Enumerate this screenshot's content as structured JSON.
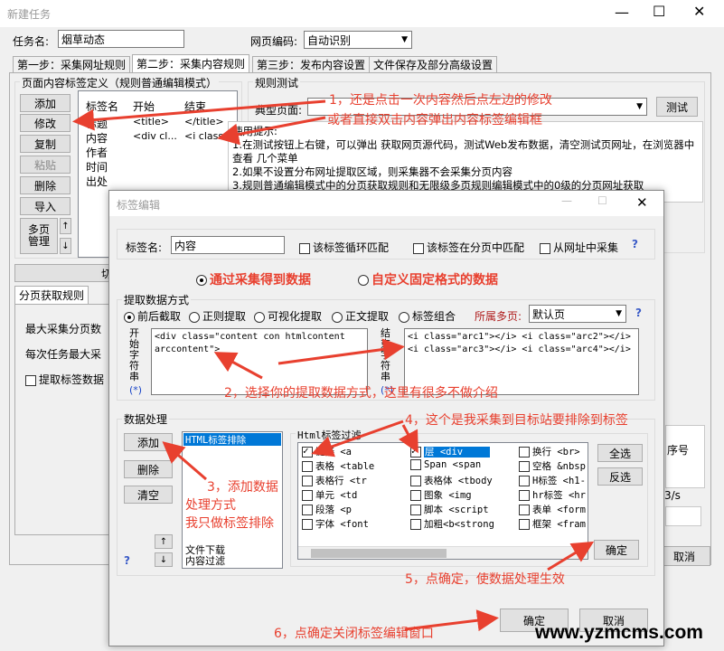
{
  "main_window": {
    "title": "新建任务",
    "task_name_label": "任务名:",
    "task_name_value": "烟草动态",
    "encoding_label": "网页编码:",
    "encoding_value": "自动识别",
    "tabs": [
      "第一步：采集网址规则",
      "第二步：采集内容规则",
      "第三步：发布内容设置",
      "文件保存及部分高级设置"
    ],
    "left_panel_title": "页面内容标签定义（规则普通编辑模式）",
    "buttons": [
      "添加",
      "修改",
      "复制",
      "粘贴",
      "删除",
      "导入"
    ],
    "multipage_btn": "多页\n管理",
    "list_headers": [
      "标签名",
      "开始",
      "结束"
    ],
    "list_rows": [
      {
        "name": "标题",
        "start": "<title>",
        "end": "</title>"
      },
      {
        "name": "内容",
        "start": "<div cl...",
        "end": "<i class..."
      },
      {
        "name": "作者",
        "start": "",
        "end": ""
      },
      {
        "name": "时间",
        "start": "",
        "end": ""
      },
      {
        "name": "出处",
        "start": "",
        "end": ""
      }
    ],
    "switch_btn": "切换到无限",
    "paging_tab": "分页获取规则",
    "max_pages_label": "最大采集分页数",
    "max_per_task_label": "每次任务最大采",
    "extract_checkbox": "提取标签数据",
    "rule_test_title": "规则测试",
    "typical_page_label": "典型页面:",
    "test_btn": "测试",
    "tips_title": "使用提示:",
    "tips": [
      "1.在测试按钮上右键，可以弹出 获取网页源代码，测试Web发布数据，清空测试页网址，在浏览器中查看 几个菜单",
      "2.如果不设置分布网址提取区域，则采集器不会采集分页内容",
      "3.规则普通编辑模式中的分页获取规则和无限级多页规则编辑模式中的0级的分页网址获取"
    ],
    "seq_label": "序号",
    "speed_label": "3/s",
    "cancel_btn": "取消"
  },
  "dialog": {
    "title": "标签编辑",
    "tag_name_label": "标签名:",
    "tag_name_value": "内容",
    "loop_match": "该标签循环匹配",
    "page_match": "该标签在分页中匹配",
    "from_url": "从网址中采集",
    "source_collect": "通过采集得到数据",
    "source_fixed": "自定义固定格式的数据",
    "extract_group": "提取数据方式",
    "extract_modes": [
      "前后截取",
      "正则提取",
      "可视化提取",
      "正文提取",
      "标签组合"
    ],
    "multipage_label": "所属多页:",
    "multipage_value": "默认页",
    "start_str_label": "开始字符串",
    "start_str_value": "<div class=\"content con htmlcontent arccontent\">",
    "end_str_label": "结束字符串",
    "end_str_value": "<i class=\"arc1\"></i> <i class=\"arc2\"></i> <i class=\"arc3\"></i> <i class=\"arc4\"></i>",
    "star_link": "(*)",
    "processing_group": "数据处理",
    "proc_buttons": [
      "添加",
      "删除",
      "清空"
    ],
    "proc_list_selected": "HTML标签排除",
    "proc_list_bottom": [
      "文件下载",
      "内容过滤"
    ],
    "html_filter_group": "Html标签过滤",
    "html_filters": [
      {
        "label": "链接 <a",
        "checked": true
      },
      {
        "label": "层 <div",
        "checked": true,
        "selected": true
      },
      {
        "label": "换行 <br>",
        "checked": false
      },
      {
        "label": "表格 <table",
        "checked": false
      },
      {
        "label": "Span <span",
        "checked": false
      },
      {
        "label": "空格 &nbsp",
        "checked": false
      },
      {
        "label": "表格行 <tr",
        "checked": false
      },
      {
        "label": "表格体 <tbody",
        "checked": false
      },
      {
        "label": "H标签 <h1-",
        "checked": false
      },
      {
        "label": "单元 <td",
        "checked": false
      },
      {
        "label": "图象 <img",
        "checked": false
      },
      {
        "label": "hr标签 <hr",
        "checked": false
      },
      {
        "label": "段落 <p",
        "checked": false
      },
      {
        "label": "脚本 <script",
        "checked": false
      },
      {
        "label": "表单 <form",
        "checked": false
      },
      {
        "label": "字体 <font",
        "checked": false
      },
      {
        "label": "加粗<b<strong",
        "checked": false
      },
      {
        "label": "框架 <fram",
        "checked": false
      }
    ],
    "select_all": "全选",
    "invert": "反选",
    "confirm_inner": "确定",
    "ok": "确定",
    "cancel": "取消"
  },
  "annotations": {
    "a1_line1": "1，还是点击一次内容然后点左边的修改",
    "a1_line2": "或者直接双击内容弹出内容标签编辑框",
    "a2": "2，选择你的提取数据方式，这里有很多不做介绍",
    "a3_line1": "3，添加数据",
    "a3_line2": "处理方式",
    "a3_line3": "我只做标签排除",
    "a4": "4，这个是我采集到目标站要排除到标签",
    "a5": "5，点确定，使数据处理生效",
    "a6": "6，点确定关闭标签编辑窗口"
  },
  "watermark": "www.yzmcms.com",
  "accent_color": "#e8402f"
}
